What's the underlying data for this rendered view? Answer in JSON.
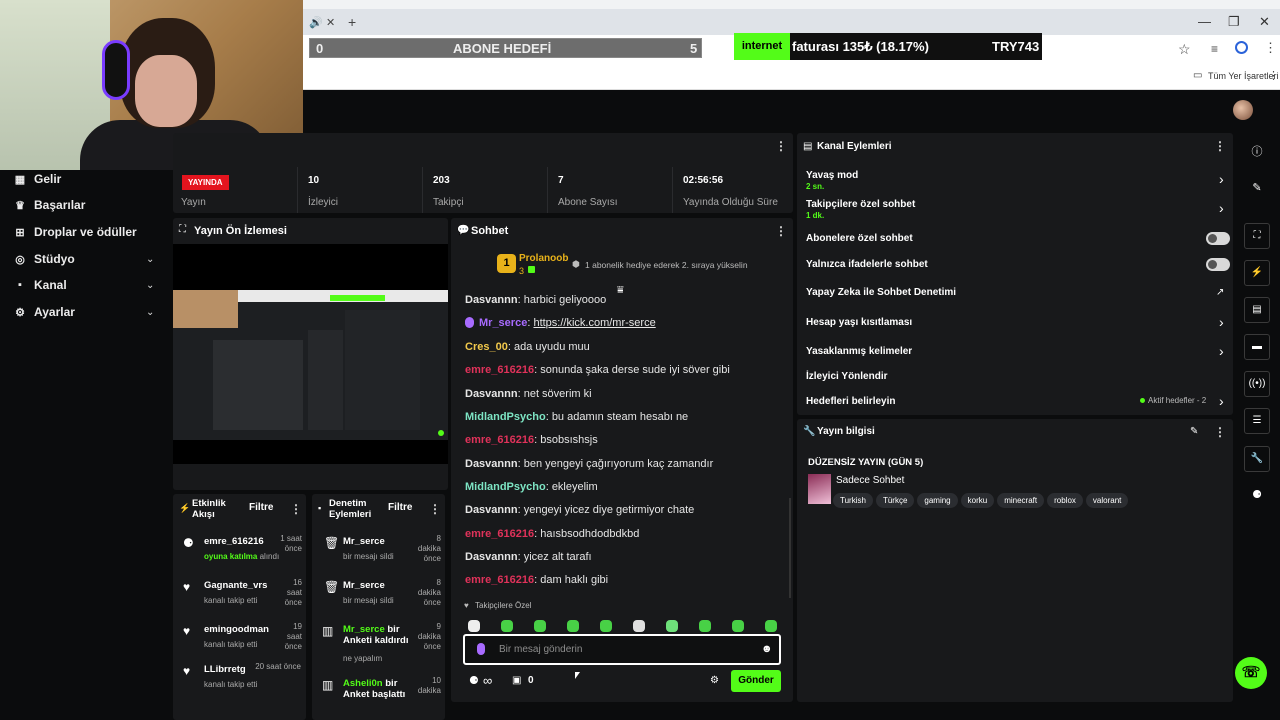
{
  "browser": {
    "tab_icons": [
      "🔊",
      "✕",
      "+"
    ],
    "bookmarks_label": "Tüm Yer İşaretleri"
  },
  "overlay": {
    "goal_left": "0",
    "goal_title": "ABONE HEDEFİ",
    "goal_right": "5",
    "ticker_tag": "internet",
    "ticker_text": "faturası 135₺ (18.17%)",
    "ticker_amount": "TRY743"
  },
  "sidebar": {
    "items": [
      {
        "label": "Gelir",
        "icon": "chart-icon"
      },
      {
        "label": "Başarılar",
        "icon": "trophy-icon"
      },
      {
        "label": "Droplar ve ödüller",
        "icon": "gift-icon"
      },
      {
        "label": "Stüdyo",
        "icon": "studio-icon"
      },
      {
        "label": "Kanal",
        "icon": "channel-icon"
      },
      {
        "label": "Ayarlar",
        "icon": "gear-icon"
      }
    ]
  },
  "stats": {
    "live_badge": "YAYINDA",
    "stream_label": "Yayın",
    "viewers": "10",
    "viewers_label": "İzleyici",
    "followers": "203",
    "followers_label": "Takipçi",
    "subs": "7",
    "subs_label": "Abone Sayısı",
    "uptime": "02:56:56",
    "uptime_label": "Yayında Olduğu Süre"
  },
  "preview": {
    "title": "Yayın Ön İzlemesi"
  },
  "chat": {
    "title": "Sohbet",
    "pinned_user": "Prolanoob",
    "pinned_count": "3",
    "pinned_rank": "1",
    "pinned_text": "1 abonelik hediye ederek 2. sıraya yükselin",
    "messages": [
      {
        "user": "Dasvannn",
        "color": "#e6e6e6",
        "text": "harbici geliyoooo"
      },
      {
        "user": "Mr_serce",
        "color": "#a86bff",
        "text": "https://kick.com/mr-serce",
        "link": true
      },
      {
        "user": "Cres_00",
        "color": "#f2c94c",
        "text": "ada uyudu muu"
      },
      {
        "user": "emre_616216",
        "color": "#e0325a",
        "text": "sonunda şaka derse sude iyi söver gibi"
      },
      {
        "user": "Dasvannn",
        "color": "#e6e6e6",
        "text": "net söverim ki"
      },
      {
        "user": "MidlandPsycho",
        "color": "#7de5c4",
        "text": "bu adamın steam hesabı ne"
      },
      {
        "user": "emre_616216",
        "color": "#e0325a",
        "text": "bsobsıshsjs"
      },
      {
        "user": "Dasvannn",
        "color": "#e6e6e6",
        "text": "ben yengeyi çağırıyorum kaç zamandır"
      },
      {
        "user": "MidlandPsycho",
        "color": "#7de5c4",
        "text": "ekleyelim"
      },
      {
        "user": "Dasvannn",
        "color": "#e6e6e6",
        "text": "yengeyi yicez diye getirmiyor chate"
      },
      {
        "user": "emre_616216",
        "color": "#e0325a",
        "text": "haısbsodhdodbdkbd"
      },
      {
        "user": "Dasvannn",
        "color": "#e6e6e6",
        "text": "yicez alt tarafı"
      },
      {
        "user": "emre_616216",
        "color": "#e0325a",
        "text": "dam haklı gibi"
      }
    ],
    "follower_only": "Takipçilere Özel",
    "input_placeholder": "Bir mesaj gönderin",
    "points": "0",
    "send_label": "Gönder",
    "infinity": "∞"
  },
  "activity": {
    "title": "Etkinlik Akışı",
    "filter": "Filtre",
    "items": [
      {
        "name": "emre_616216",
        "time": "1 saat önce",
        "sub_green": "oyuna katılma",
        "sub": "alındı",
        "icon": "game-icon"
      },
      {
        "name": "Gagnante_vrs",
        "time": "16 saat önce",
        "sub": "kanalı takip etti",
        "icon": "heart-icon"
      },
      {
        "name": "emingoodman",
        "time": "19 saat önce",
        "sub": "kanalı takip etti",
        "icon": "heart-icon"
      },
      {
        "name": "LLibrretg",
        "time": "20 saat önce",
        "sub": "kanalı takip etti",
        "icon": "heart-icon"
      }
    ]
  },
  "moderation": {
    "title": "Denetim Eylemleri",
    "filter": "Filtre",
    "items": [
      {
        "name": "Mr_serce",
        "time": "8 dakika önce",
        "sub": "bir mesajı sildi",
        "icon": "trash-icon"
      },
      {
        "name": "Mr_serce",
        "time": "8 dakika önce",
        "sub": "bir mesajı sildi",
        "icon": "trash-icon"
      },
      {
        "name": "Mr_serce",
        "name_suffix": "bir Anketi kaldırdı",
        "time": "9 dakika önce",
        "sub": "ne yapalım",
        "icon": "poll-icon"
      },
      {
        "name": "Asheli0n",
        "name_suffix": "bir Anket başlattı",
        "time": "10 dakika",
        "sub": "",
        "icon": "poll-icon"
      }
    ]
  },
  "channel_actions": {
    "title": "Kanal Eylemleri",
    "items": [
      {
        "label": "Yavaş mod",
        "sub": "2 sn.",
        "control": "arrow"
      },
      {
        "label": "Takipçilere özel sohbet",
        "sub": "1 dk.",
        "control": "arrow"
      },
      {
        "label": "Abonelere özel sohbet",
        "control": "toggle"
      },
      {
        "label": "Yalnızca ifadelerle sohbet",
        "control": "toggle"
      },
      {
        "label": "Yapay Zeka ile Sohbet Denetimi",
        "control": "external"
      },
      {
        "label": "Hesap yaşı kısıtlaması",
        "control": "arrow"
      },
      {
        "label": "Yasaklanmış kelimeler",
        "control": "arrow"
      },
      {
        "label": "İzleyici Yönlendir",
        "control": "none"
      },
      {
        "label": "Hedefleri belirleyin",
        "control": "arrow",
        "badge": "Aktif hedefler - 2"
      }
    ]
  },
  "stream_info": {
    "title": "Yayın bilgisi",
    "stream_title": "DÜZENSİZ YAYIN (GÜN 5)",
    "category": "Sadece Sohbet",
    "tags": [
      "Turkish",
      "Türkçe",
      "gaming",
      "korku",
      "minecraft",
      "roblox",
      "valorant"
    ]
  },
  "colors": {
    "accent": "#53fc18",
    "live": "#e4141e",
    "panel": "#18191b",
    "bg": "#0b0c0d"
  }
}
